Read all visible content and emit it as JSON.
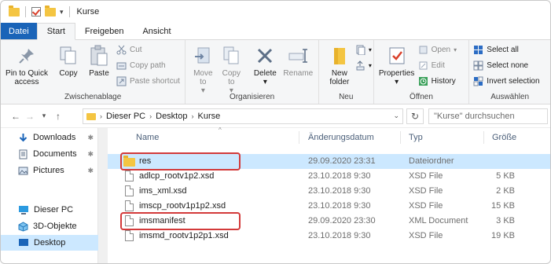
{
  "window": {
    "title": "Kurse"
  },
  "ribbon_tabs": [
    "Datei",
    "Start",
    "Freigeben",
    "Ansicht"
  ],
  "ribbon": {
    "clipboard": {
      "label": "Zwischenablage",
      "pin": "Pin to Quick access",
      "copy": "Copy",
      "paste": "Paste",
      "cut": "Cut",
      "copy_path": "Copy path",
      "paste_shortcut": "Paste shortcut"
    },
    "organise": {
      "label": "Organisieren",
      "move_to": "Move to",
      "copy_to": "Copy to",
      "delete": "Delete",
      "rename": "Rename"
    },
    "new": {
      "label": "Neu",
      "new_folder": "New folder"
    },
    "open": {
      "label": "Öffnen",
      "properties": "Properties",
      "open": "Open",
      "edit": "Edit",
      "history": "History"
    },
    "select": {
      "label": "Auswählen",
      "select_all": "Select all",
      "select_none": "Select none",
      "invert": "Invert selection"
    }
  },
  "address": {
    "crumbs": [
      "Dieser PC",
      "Desktop",
      "Kurse"
    ],
    "search_placeholder": "\"Kurse\" durchsuchen"
  },
  "nav": {
    "quick": [
      {
        "label": "Downloads",
        "icon": "download-arrow-icon"
      },
      {
        "label": "Documents",
        "icon": "documents-icon"
      },
      {
        "label": "Pictures",
        "icon": "pictures-icon"
      }
    ],
    "this_pc": "Dieser PC",
    "pc_items": [
      {
        "label": "3D-Objekte",
        "icon": "3d-objects-icon"
      },
      {
        "label": "Desktop",
        "icon": "desktop-icon",
        "selected": true
      }
    ]
  },
  "columns": {
    "name": "Name",
    "modified": "Änderungsdatum",
    "type": "Typ",
    "size": "Größe"
  },
  "files": [
    {
      "name": "res",
      "modified": "29.09.2020 23:31",
      "type": "Dateiordner",
      "size": "",
      "kind": "folder",
      "selected": true,
      "highlighted": true
    },
    {
      "name": "adlcp_rootv1p2.xsd",
      "modified": "23.10.2018 9:30",
      "type": "XSD File",
      "size": "5 KB",
      "kind": "file"
    },
    {
      "name": "ims_xml.xsd",
      "modified": "23.10.2018 9:30",
      "type": "XSD File",
      "size": "2 KB",
      "kind": "file"
    },
    {
      "name": "imscp_rootv1p1p2.xsd",
      "modified": "23.10.2018 9:30",
      "type": "XSD File",
      "size": "15 KB",
      "kind": "file"
    },
    {
      "name": "imsmanifest",
      "modified": "29.09.2020 23:30",
      "type": "XML Document",
      "size": "3 KB",
      "kind": "file",
      "highlighted": true
    },
    {
      "name": "imsmd_rootv1p2p1.xsd",
      "modified": "23.10.2018 9:30",
      "type": "XSD File",
      "size": "19 KB",
      "kind": "file"
    }
  ],
  "colors": {
    "file_tab": "#1a64b8",
    "selection": "#cce8ff",
    "highlight": "#d33a3a",
    "folder": "#f4c542"
  }
}
